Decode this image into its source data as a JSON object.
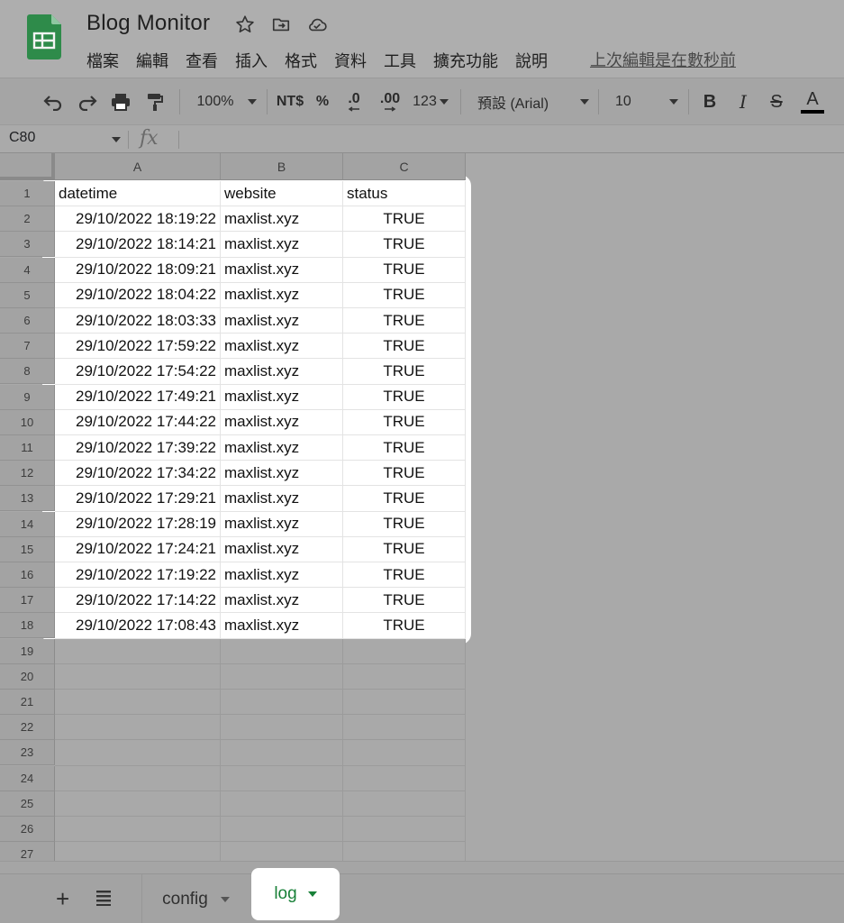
{
  "app": {
    "title": "Blog Monitor",
    "last_edit": "上次編輯是在數秒前",
    "menu": [
      "檔案",
      "編輯",
      "查看",
      "插入",
      "格式",
      "資料",
      "工具",
      "擴充功能",
      "說明"
    ]
  },
  "toolbar": {
    "zoom": "100%",
    "currency": "NT$",
    "percent": "%",
    "dec_decrease": ".0",
    "dec_increase": ".00",
    "more_formats": "123",
    "font": "預設 (Arial)",
    "font_size": "10",
    "bold": "B",
    "italic": "I",
    "strike": "S",
    "text_color": "A"
  },
  "formula_bar": {
    "name_box": "C80",
    "fx": "fx"
  },
  "grid": {
    "columns": [
      "A",
      "B",
      "C"
    ],
    "row_numbers": [
      "1",
      "2",
      "3",
      "4",
      "5",
      "6",
      "7",
      "8",
      "9",
      "10",
      "11",
      "12",
      "13",
      "14",
      "15",
      "16",
      "17",
      "18",
      "19",
      "20",
      "21",
      "22",
      "23",
      "24",
      "25",
      "26",
      "27"
    ],
    "header": [
      "datetime",
      "website",
      "status"
    ],
    "rows": [
      [
        "29/10/2022 18:19:22",
        "maxlist.xyz",
        "TRUE"
      ],
      [
        "29/10/2022 18:14:21",
        "maxlist.xyz",
        "TRUE"
      ],
      [
        "29/10/2022 18:09:21",
        "maxlist.xyz",
        "TRUE"
      ],
      [
        "29/10/2022 18:04:22",
        "maxlist.xyz",
        "TRUE"
      ],
      [
        "29/10/2022 18:03:33",
        "maxlist.xyz",
        "TRUE"
      ],
      [
        "29/10/2022 17:59:22",
        "maxlist.xyz",
        "TRUE"
      ],
      [
        "29/10/2022 17:54:22",
        "maxlist.xyz",
        "TRUE"
      ],
      [
        "29/10/2022 17:49:21",
        "maxlist.xyz",
        "TRUE"
      ],
      [
        "29/10/2022 17:44:22",
        "maxlist.xyz",
        "TRUE"
      ],
      [
        "29/10/2022 17:39:22",
        "maxlist.xyz",
        "TRUE"
      ],
      [
        "29/10/2022 17:34:22",
        "maxlist.xyz",
        "TRUE"
      ],
      [
        "29/10/2022 17:29:21",
        "maxlist.xyz",
        "TRUE"
      ],
      [
        "29/10/2022 17:28:19",
        "maxlist.xyz",
        "TRUE"
      ],
      [
        "29/10/2022 17:24:21",
        "maxlist.xyz",
        "TRUE"
      ],
      [
        "29/10/2022 17:19:22",
        "maxlist.xyz",
        "TRUE"
      ],
      [
        "29/10/2022 17:14:22",
        "maxlist.xyz",
        "TRUE"
      ],
      [
        "29/10/2022 17:08:43",
        "maxlist.xyz",
        "TRUE"
      ]
    ]
  },
  "sheets": {
    "add": "+",
    "tabs": [
      "config",
      "log"
    ],
    "active": "log"
  },
  "colors": {
    "sheets_green": "#188038",
    "logo_green": "#2e8b4a",
    "highlight": "#ffffff"
  },
  "icons": [
    "star-icon",
    "move-to-folder-icon",
    "cloud-saved-icon",
    "undo-icon",
    "redo-icon",
    "print-icon",
    "paint-format-icon",
    "all-sheets-icon"
  ]
}
